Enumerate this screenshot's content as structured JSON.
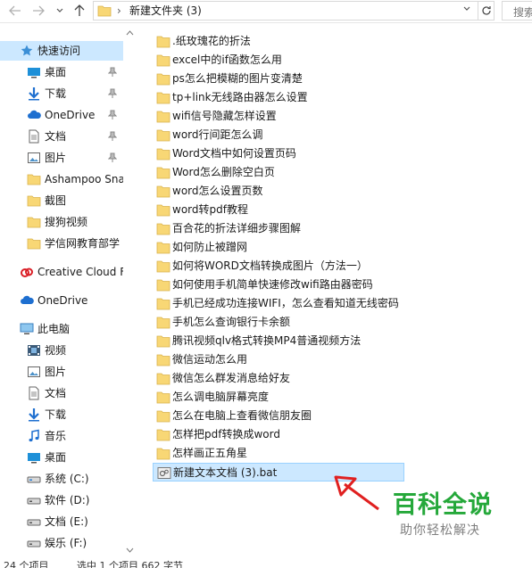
{
  "address": {
    "path": "新建文件夹 (3)",
    "search_placeholder": "搜索"
  },
  "nav": {
    "quick_access": "快速访问",
    "quick_items": [
      {
        "label": "桌面",
        "icon": "desktop-icon",
        "pinned": true
      },
      {
        "label": "下载",
        "icon": "download-icon",
        "pinned": true
      },
      {
        "label": "OneDrive",
        "icon": "onedrive-icon",
        "pinned": true
      },
      {
        "label": "文档",
        "icon": "documents-icon",
        "pinned": true
      },
      {
        "label": "图片",
        "icon": "pictures-icon",
        "pinned": true
      },
      {
        "label": "Ashampoo Sna",
        "icon": "folder-icon",
        "pinned": false
      },
      {
        "label": "截图",
        "icon": "folder-icon",
        "pinned": false
      },
      {
        "label": "搜狗视频",
        "icon": "folder-icon",
        "pinned": false
      },
      {
        "label": "学信网教育部学",
        "icon": "folder-icon",
        "pinned": false
      }
    ],
    "creative_cloud": "Creative Cloud F",
    "onedrive": "OneDrive",
    "this_pc": "此电脑",
    "pc_items": [
      {
        "label": "视频",
        "icon": "videos-icon"
      },
      {
        "label": "图片",
        "icon": "pictures-icon"
      },
      {
        "label": "文档",
        "icon": "documents-icon"
      },
      {
        "label": "下载",
        "icon": "download-icon"
      },
      {
        "label": "音乐",
        "icon": "music-icon"
      },
      {
        "label": "桌面",
        "icon": "desktop-icon"
      },
      {
        "label": "系统 (C:)",
        "icon": "drive-icon"
      },
      {
        "label": "软件 (D:)",
        "icon": "drive-icon"
      },
      {
        "label": "文档 (E:)",
        "icon": "drive-icon"
      },
      {
        "label": "娱乐 (F:)",
        "icon": "drive-icon"
      }
    ]
  },
  "files": [
    ".纸玫瑰花的折法",
    "excel中的if函数怎么用",
    "ps怎么把模糊的图片变清楚",
    "tp+link无线路由器怎么设置",
    "wifi信号隐藏怎样设置",
    "word行间距怎么调",
    "Word文档中如何设置页码",
    "Word怎么删除空白页",
    "word怎么设置页数",
    "word转pdf教程",
    "百合花的折法详细步骤图解",
    "如何防止被蹭网",
    "如何将WORD文档转换成图片（方法一）",
    "如何使用手机简单快速修改wifi路由器密码",
    "手机已经成功连接WIFI，怎么查看知道无线密码",
    "手机怎么查询银行卡余额",
    "腾讯视频qlv格式转换MP4普通视频方法",
    "微信运动怎么用",
    "微信怎么群发消息给好友",
    "怎么调电脑屏幕亮度",
    "怎么在电脑上查看微信朋友圈",
    "怎样把pdf转换成word",
    "怎样画正五角星"
  ],
  "selected_file": "新建文本文档 (3).bat",
  "status": {
    "count": "24 个项目",
    "selected": "选中 1 个项目  662 字节"
  },
  "watermark": {
    "title": "百科全说",
    "subtitle": "助你轻松解决"
  },
  "colors": {
    "selection": "#cce8ff",
    "folder": "#f8d775",
    "watermark_green": "#25a83a",
    "arrow_red": "#e02020"
  }
}
